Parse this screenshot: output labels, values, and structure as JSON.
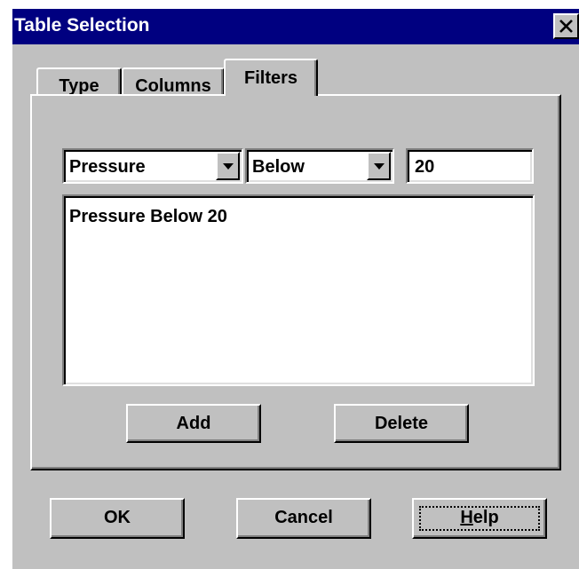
{
  "window": {
    "title": "Table Selection",
    "close_icon": "close-icon"
  },
  "tabs": [
    {
      "label": "Type",
      "selected": false
    },
    {
      "label": "Columns",
      "selected": false
    },
    {
      "label": "Filters",
      "selected": true
    }
  ],
  "filters": {
    "field": {
      "selected": "Pressure"
    },
    "operator": {
      "selected": "Below"
    },
    "value": "20",
    "list_items": [
      "Pressure Below 20"
    ],
    "add_label": "Add",
    "delete_label": "Delete"
  },
  "buttons": {
    "ok_label": "OK",
    "cancel_label": "Cancel",
    "help_mnemonic": "H",
    "help_rest": "elp"
  },
  "colors": {
    "title_bar": "#000080",
    "face": "#c0c0c0",
    "field_bg": "#ffffff"
  }
}
